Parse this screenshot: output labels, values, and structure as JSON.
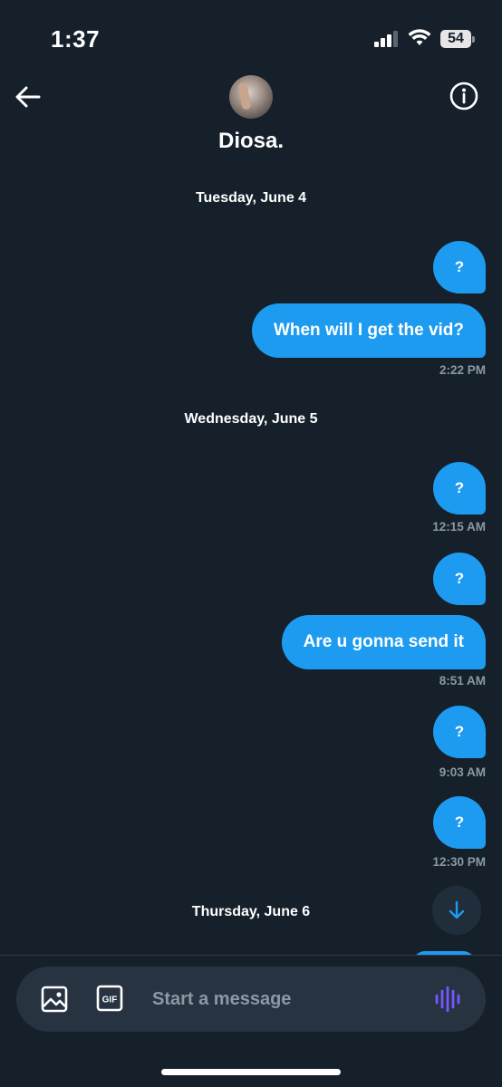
{
  "status_bar": {
    "time": "1:37",
    "battery": "54"
  },
  "header": {
    "contact_name": "Diosa."
  },
  "thread": [
    {
      "type": "date",
      "label": "Tuesday, June 4"
    },
    {
      "type": "message",
      "text": "?"
    },
    {
      "type": "message",
      "text": "When will I get the vid?",
      "time": "2:22 PM"
    },
    {
      "type": "date",
      "label": "Wednesday, June 5"
    },
    {
      "type": "message",
      "text": "?",
      "time": "12:15 AM"
    },
    {
      "type": "message",
      "text": "?"
    },
    {
      "type": "message",
      "text": "Are  u gonna send it",
      "time": "8:51 AM"
    },
    {
      "type": "message",
      "text": "?",
      "time": "9:03 AM"
    },
    {
      "type": "message",
      "text": "?",
      "time": "12:30 PM"
    },
    {
      "type": "date",
      "label": "Thursday, June 6"
    }
  ],
  "composer": {
    "placeholder": "Start a message",
    "gif_label": "GIF"
  },
  "colors": {
    "background": "#15202b",
    "bubble": "#1d9bf0",
    "timestamp": "#8b98a5",
    "voice_accent": "#7856ff"
  },
  "icons": {
    "back": "arrow-left-icon",
    "info": "info-icon",
    "scroll": "arrow-down-icon",
    "media": "image-icon",
    "gif": "gif-icon",
    "voice": "waveform-icon"
  }
}
